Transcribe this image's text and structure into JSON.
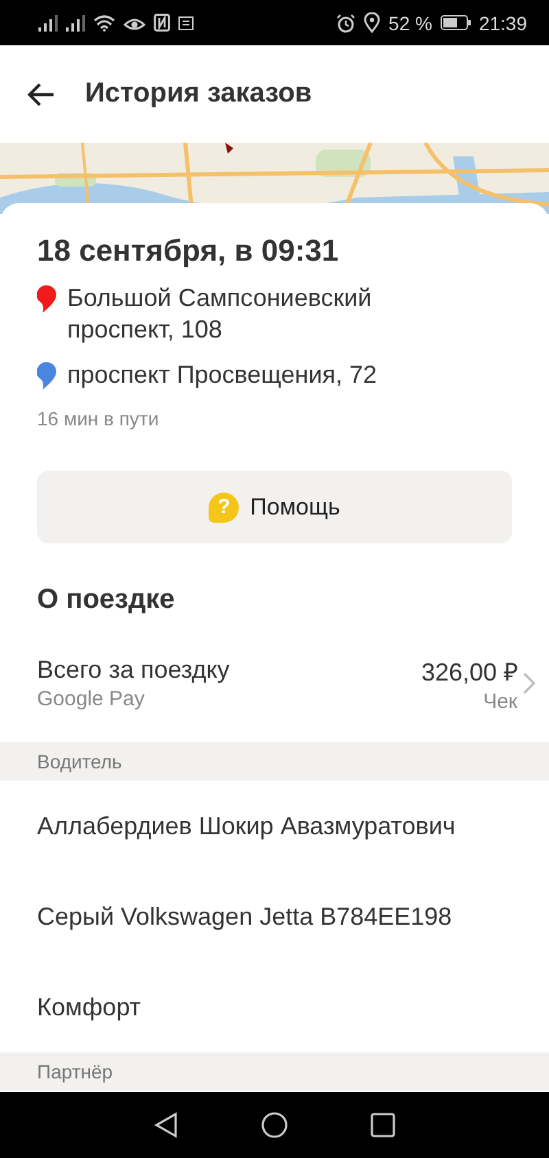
{
  "status_bar": {
    "battery_percent": "52 %",
    "time": "21:39"
  },
  "header": {
    "title": "История заказов"
  },
  "order": {
    "date": "18 сентября, в 09:31",
    "route": [
      {
        "address": "Большой Сампсониевский проспект, 108",
        "color": "#f01a1a"
      },
      {
        "address": "проспект Просвещения, 72",
        "color": "#4a86e0"
      }
    ],
    "duration": "16 мин в пути"
  },
  "help_button": {
    "label": "Помощь",
    "icon_glyph": "?"
  },
  "trip": {
    "title": "О поездке",
    "total_label": "Всего за поездку",
    "payment": "Google Pay",
    "amount": "326,00 ₽",
    "receipt": "Чек"
  },
  "sections": [
    {
      "title": "Водитель",
      "rows": [
        "Аллабердиев Шокир Авазмуратович",
        "Серый Volkswagen Jetta В784ЕЕ198",
        "Комфорт"
      ]
    },
    {
      "title": "Партнёр"
    }
  ]
}
